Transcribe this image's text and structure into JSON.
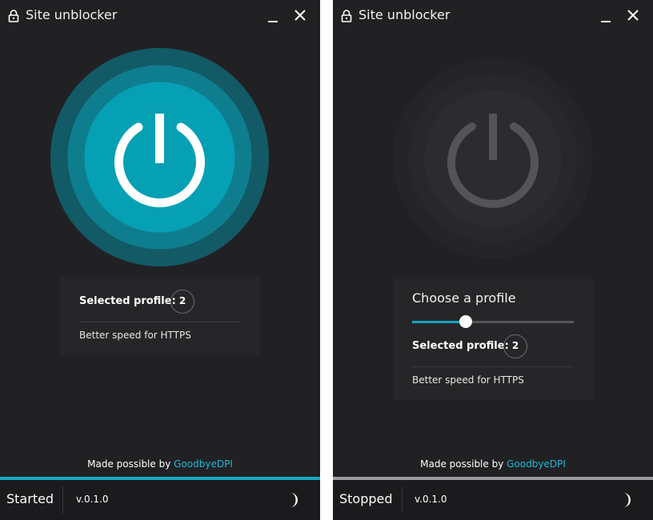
{
  "left_window": {
    "title": "Site unblocker",
    "state": "on",
    "accent_color": "#18a4c0",
    "profile": {
      "selected_label": "Selected profile:",
      "selected_value": "2",
      "description": "Better speed for HTTPS"
    },
    "credit": {
      "prefix": "Made possible by",
      "link_text": "GoodbyeDPI"
    },
    "footer": {
      "status": "Started",
      "version": "v.0.1.0"
    },
    "icons": {
      "lock": "lock-icon",
      "minimize": "minimize-icon",
      "close": "close-icon",
      "power": "power-icon",
      "theme": "moon-icon"
    }
  },
  "right_window": {
    "title": "Site unblocker",
    "state": "off",
    "accent_color": "#9b9b9e",
    "profile": {
      "chooser_title": "Choose a profile",
      "slider_position": 0.33,
      "selected_label": "Selected profile:",
      "selected_value": "2",
      "description": "Better speed for HTTPS"
    },
    "credit": {
      "prefix": "Made possible by",
      "link_text": "GoodbyeDPI"
    },
    "footer": {
      "status": "Stopped",
      "version": "v.0.1.0"
    },
    "icons": {
      "lock": "lock-icon",
      "minimize": "minimize-icon",
      "close": "close-icon",
      "power": "power-icon",
      "theme": "moon-icon"
    }
  }
}
